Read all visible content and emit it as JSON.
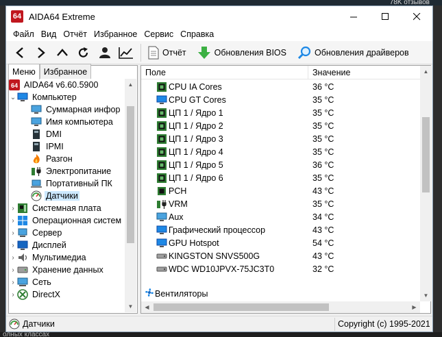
{
  "background": {
    "badge": "78K отзывов",
    "bottom_text": "олных классах"
  },
  "window": {
    "title": "AIDA64 Extreme",
    "logo": "64"
  },
  "menu": [
    "Файл",
    "Вид",
    "Отчёт",
    "Избранное",
    "Сервис",
    "Справка"
  ],
  "toolbar": {
    "report": "Отчёт",
    "bios": "Обновления BIOS",
    "drivers": "Обновления драйверов"
  },
  "tabs": {
    "menu": "Меню",
    "favorites": "Избранное"
  },
  "tree": {
    "root": "AIDA64 v6.60.5900",
    "computer": "Компьютер",
    "summary": "Суммарная инфор",
    "computer_name": "Имя компьютера",
    "dmi": "DMI",
    "ipmi": "IPMI",
    "overclock": "Разгон",
    "power": "Электропитание",
    "portable": "Портативный ПК",
    "sensors": "Датчики",
    "motherboard": "Системная плата",
    "os": "Операционная систем",
    "server": "Сервер",
    "display": "Дисплей",
    "multimedia": "Мультимедиа",
    "storage": "Хранение данных",
    "network": "Сеть",
    "directx": "DirectX"
  },
  "columns": {
    "field": "Поле",
    "value": "Значение"
  },
  "rows": [
    {
      "name": "CPU IA Cores",
      "value": "36 °C",
      "icon": "cpu-chip-icon"
    },
    {
      "name": "CPU GT Cores",
      "value": "35 °C",
      "icon": "gpu-monitor-icon"
    },
    {
      "name": "ЦП 1 / Ядро 1",
      "value": "35 °C",
      "icon": "cpu-chip-icon"
    },
    {
      "name": "ЦП 1 / Ядро 2",
      "value": "35 °C",
      "icon": "cpu-chip-icon"
    },
    {
      "name": "ЦП 1 / Ядро 3",
      "value": "35 °C",
      "icon": "cpu-chip-icon"
    },
    {
      "name": "ЦП 1 / Ядро 4",
      "value": "35 °C",
      "icon": "cpu-chip-icon"
    },
    {
      "name": "ЦП 1 / Ядро 5",
      "value": "36 °C",
      "icon": "cpu-chip-icon"
    },
    {
      "name": "ЦП 1 / Ядро 6",
      "value": "35 °C",
      "icon": "cpu-chip-icon"
    },
    {
      "name": "PCH",
      "value": "43 °C",
      "icon": "chip-icon"
    },
    {
      "name": "VRM",
      "value": "35 °C",
      "icon": "power-plug-icon"
    },
    {
      "name": "Aux",
      "value": "34 °C",
      "icon": "monitor-icon"
    },
    {
      "name": "Графический процессор",
      "value": "43 °C",
      "icon": "gpu-monitor-icon"
    },
    {
      "name": "GPU Hotspot",
      "value": "54 °C",
      "icon": "gpu-monitor-icon"
    },
    {
      "name": "KINGSTON SNVS500G",
      "value": "43 °C",
      "icon": "drive-icon"
    },
    {
      "name": "WDC WD10JPVX-75JC3T0",
      "value": "32 °C",
      "icon": "drive-icon"
    }
  ],
  "group_fans": "Вентиляторы",
  "status": {
    "left": "Датчики",
    "right": "Copyright (c) 1995-2021"
  }
}
